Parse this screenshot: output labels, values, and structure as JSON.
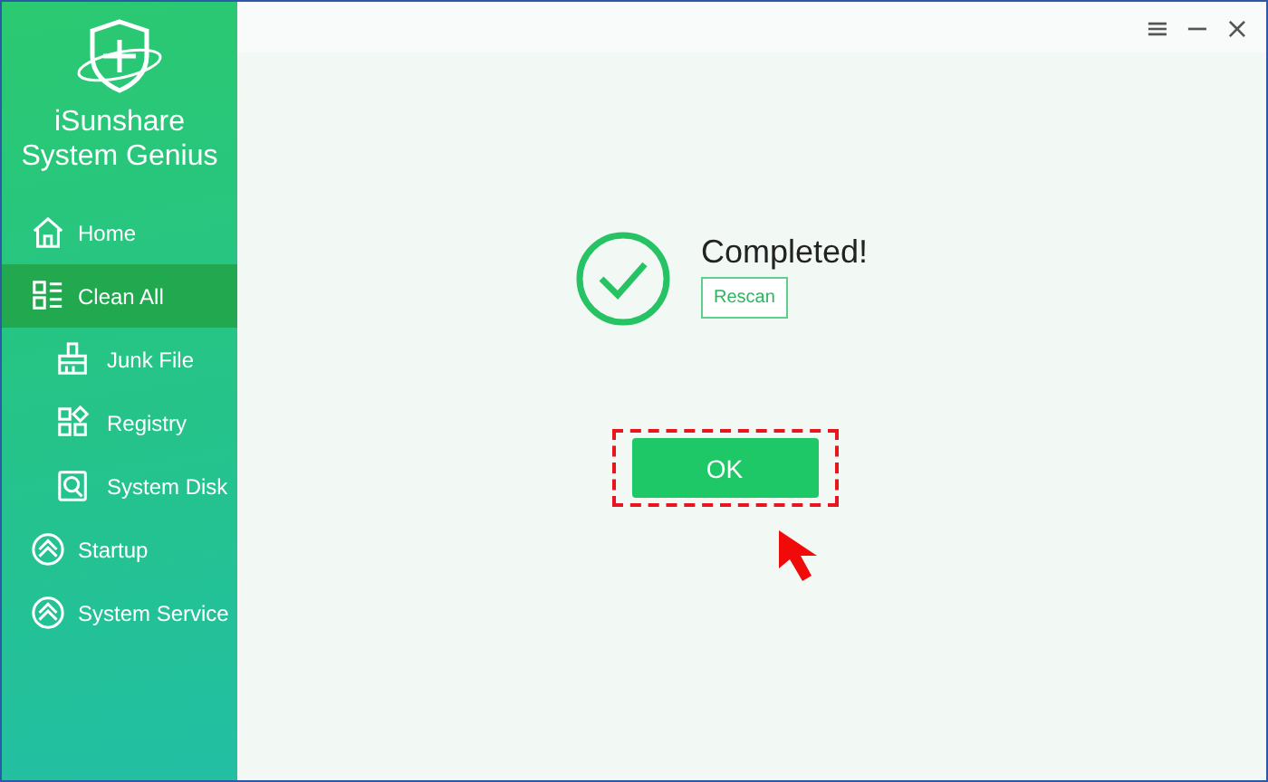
{
  "app": {
    "title": "iSunshare System Genius"
  },
  "window_controls": [
    "≡",
    "−",
    "×"
  ],
  "sidebar": {
    "items": [
      {
        "label": "Home",
        "kind": "main",
        "selected": false
      },
      {
        "label": "Clean All",
        "kind": "main",
        "selected": true
      },
      {
        "label": "Junk File",
        "kind": "sub",
        "selected": false
      },
      {
        "label": "Registry",
        "kind": "sub",
        "selected": false
      },
      {
        "label": "System Disk",
        "kind": "sub",
        "selected": false
      },
      {
        "label": "Startup",
        "kind": "main",
        "selected": false
      },
      {
        "label": "System Service",
        "kind": "main",
        "selected": false
      }
    ]
  },
  "result": {
    "message": "Completed!",
    "rescan_button": "Rescan",
    "ok_button": "OK"
  }
}
